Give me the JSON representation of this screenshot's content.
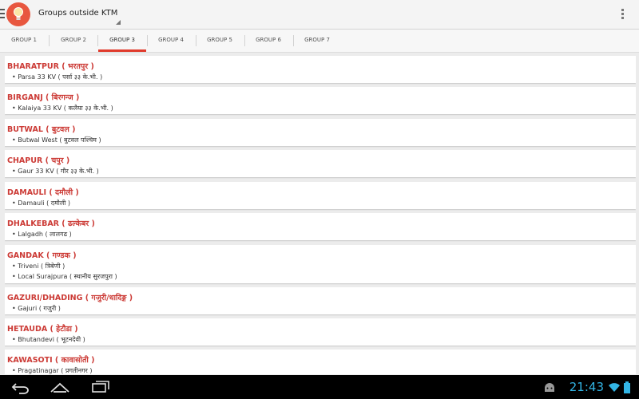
{
  "app": {
    "title": "Groups outside KTM",
    "icon": "lightbulb-icon",
    "accent": "#e8573f"
  },
  "tabs": [
    {
      "label": "GROUP 1"
    },
    {
      "label": "GROUP 2"
    },
    {
      "label": "GROUP 3",
      "selected": true
    },
    {
      "label": "GROUP 4"
    },
    {
      "label": "GROUP 5"
    },
    {
      "label": "GROUP 6"
    },
    {
      "label": "GROUP 7"
    }
  ],
  "groups": [
    {
      "title": "BHARATPUR ( भरतपुर )",
      "items": [
        "• Parsa 33 KV ( पर्सा ३३ के.भी. )"
      ]
    },
    {
      "title": "BIRGANJ ( बिरगन्ज )",
      "items": [
        "• Kalaiya 33 KV ( कलैया ३३ के.भी. )"
      ]
    },
    {
      "title": "BUTWAL ( बुटवल )",
      "items": [
        "• Butwal West ( बुटवल पश्चिम )"
      ]
    },
    {
      "title": "CHAPUR ( चपुर )",
      "items": [
        "• Gaur 33 KV ( गौर ३३ के.भी. )"
      ]
    },
    {
      "title": "DAMAULI ( दमौली )",
      "items": [
        "• Damauli ( दमौली )"
      ]
    },
    {
      "title": "DHALKEBAR ( ढल्केबर )",
      "items": [
        "• Lalgadh ( लालगढ )"
      ]
    },
    {
      "title": "GANDAK ( गण्डक )",
      "items": [
        "• Triveni ( त्रिबेणी )",
        "• Local Surajpura ( स्थानीय सुरजपुरा )"
      ]
    },
    {
      "title": "GAZURI/DHADING ( गजुरी/धादिङ्ग )",
      "items": [
        "• Gajuri ( गजुरी )"
      ]
    },
    {
      "title": "HETAUDA ( हेटौडा )",
      "items": [
        "• Bhutandevi ( भूटनदेवी )"
      ]
    },
    {
      "title": "KAWASOTI ( कावासोती )",
      "items": [
        "• Pragatinagar ( प्रगतीनगर )"
      ]
    }
  ],
  "status": {
    "time": "21:43",
    "time_color": "#33b5e5"
  },
  "nav": {
    "back_icon": "back-icon",
    "home_icon": "home-icon",
    "recents_icon": "recent-apps-icon"
  }
}
